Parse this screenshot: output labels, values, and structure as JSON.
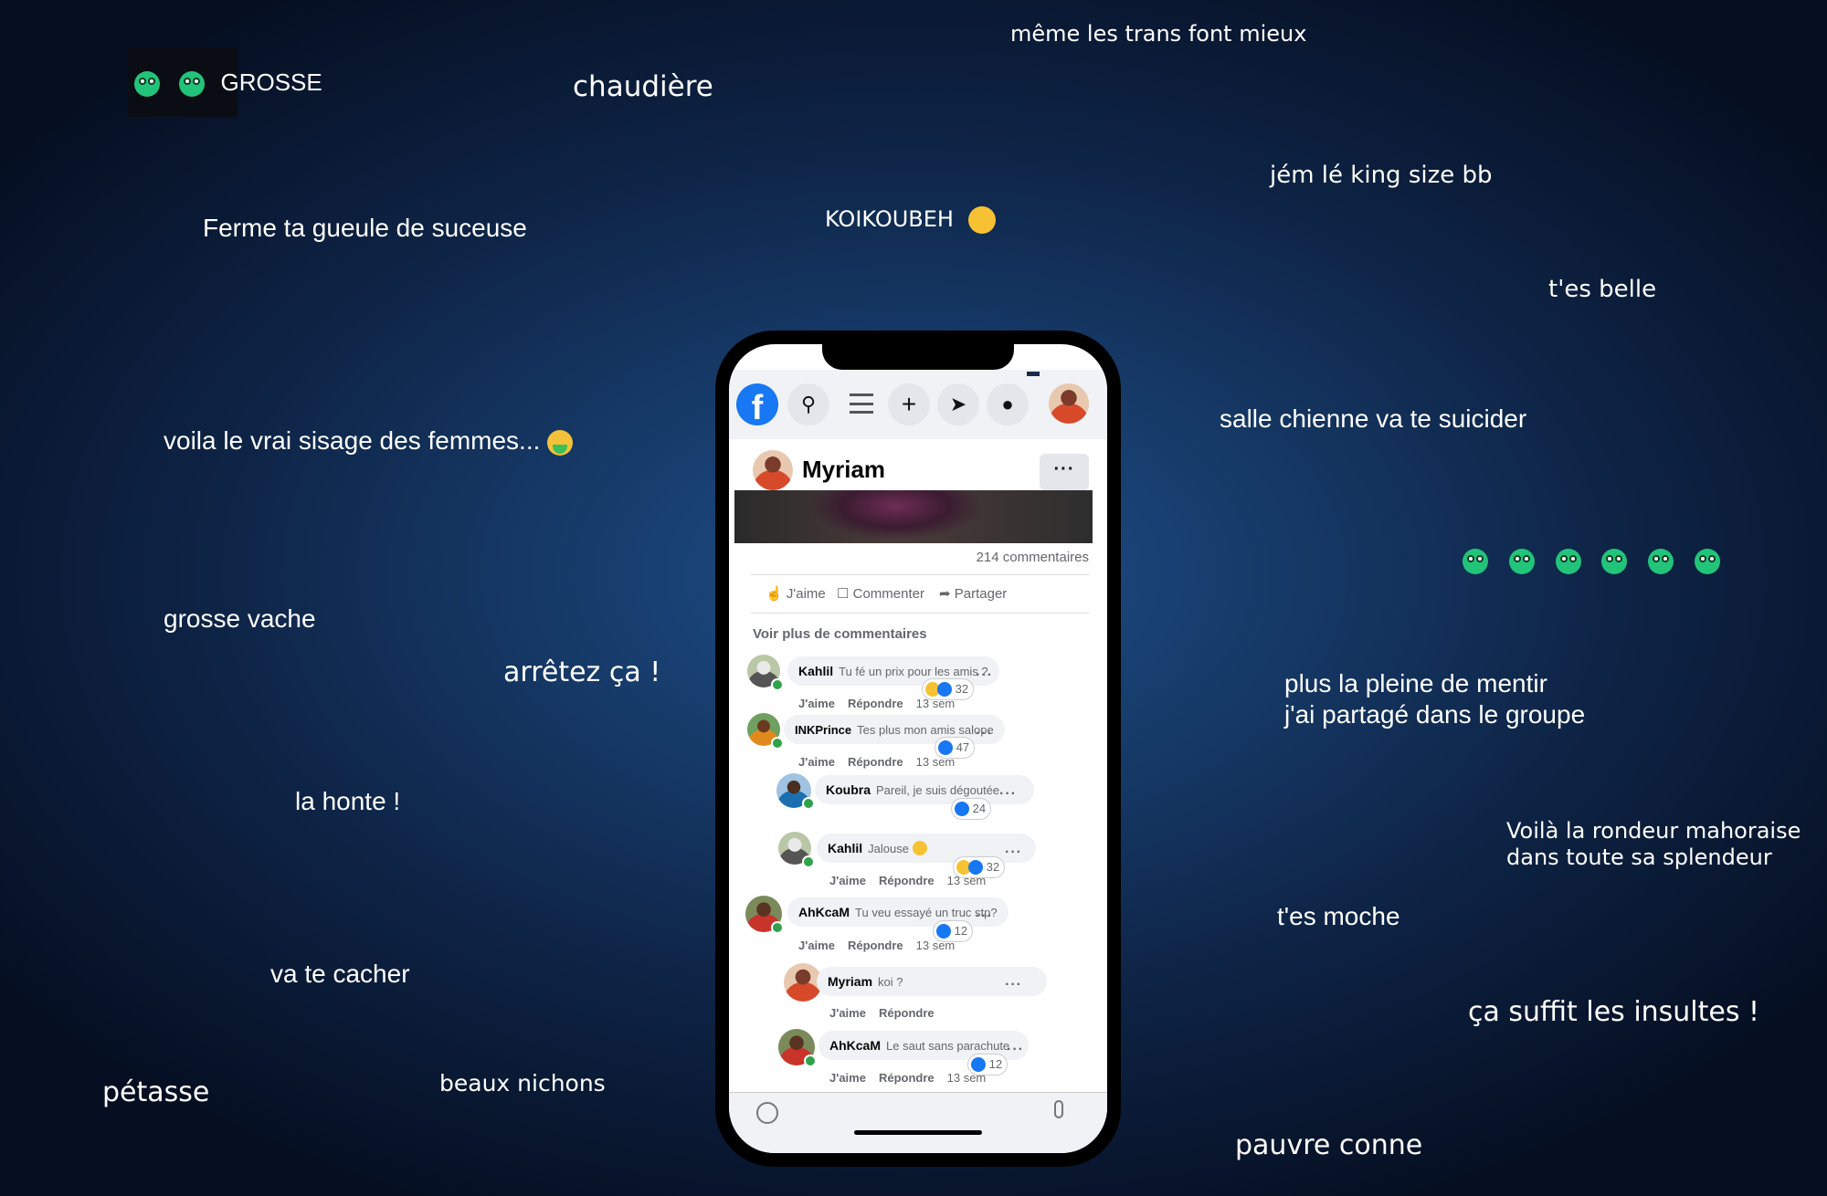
{
  "floating_comments": {
    "grosse": "GROSSE",
    "chaudiere": "chaudière",
    "meme_les_trans": "même les trans font mieux",
    "jem_le_king": "jém lé king size bb",
    "ferme_ta_gueule": "Ferme ta gueule de suceuse",
    "koikoubeh": "KOIKOUBEH",
    "tes_belle": "t'es belle",
    "voila_le_vrai": "voila le vrai sisage des femmes...",
    "salle_chienne": "salle chienne va te suicider",
    "grosse_vache": "grosse vache",
    "arretez_ca": "arrêtez ça !",
    "plus_la_pleine": "plus la pleine de mentir\nj'ai partagé dans le groupe",
    "la_honte": "la honte !",
    "voila_la_rondeur": "Voilà la rondeur mahoraise\ndans toute sa splendeur",
    "tes_moche": "t'es moche",
    "va_te_cacher": "va te cacher",
    "ca_suffit": "ça suffit les insultes !",
    "petasse": "pétasse",
    "beaux_nichons": "beaux nichons",
    "pauvre_conne": "pauvre conne"
  },
  "emoji_icons": [
    "sick-face-icon",
    "laughing-face-icon",
    "vomiting-face-icon"
  ],
  "phone": {
    "topbar": {
      "logo": "f",
      "search_icon": "search-icon",
      "plus": "+",
      "messenger_icon": "messenger-icon",
      "notif_icon": "bell-icon"
    },
    "post": {
      "author": "Myriam",
      "more": "···",
      "comment_count": "214 commentaires"
    },
    "actions": {
      "like": "J'aime",
      "comment": "Commenter",
      "share": "Partager"
    },
    "see_more": "Voir plus de commentaires",
    "comments": [
      {
        "author": "Kahlil",
        "text": "Tu fé un prix pour les amis ?",
        "like": "J'aime",
        "reply": "Répondre",
        "time": "13 sem",
        "reactions": "32"
      },
      {
        "author": "INKPrince",
        "text": "Tes plus mon amis salope",
        "like": "J'aime",
        "reply": "Répondre",
        "time": "13 sem",
        "reactions": "47"
      },
      {
        "author": "Koubra",
        "text": "Pareil, je suis dégoutée",
        "reactions": "24"
      },
      {
        "author": "Kahlil",
        "text": "Jalouse",
        "like": "J'aime",
        "reply": "Répondre",
        "time": "13 sem",
        "reactions": "32"
      },
      {
        "author": "AhKcaM",
        "text": "Tu veu essayé un truc stp?",
        "like": "J'aime",
        "reply": "Répondre",
        "time": "13 sem",
        "reactions": "12"
      },
      {
        "author": "Myriam",
        "text": "koi ?",
        "like": "J'aime",
        "reply": "Répondre"
      },
      {
        "author": "AhKcaM",
        "text": "Le saut sans parachute",
        "like": "J'aime",
        "reply": "Répondre",
        "time": "13 sem",
        "reactions": "12"
      }
    ],
    "more_dots": "···"
  },
  "colors": {
    "facebook_blue": "#1877f2",
    "background": "#0e2446",
    "online_green": "#31a24c"
  }
}
